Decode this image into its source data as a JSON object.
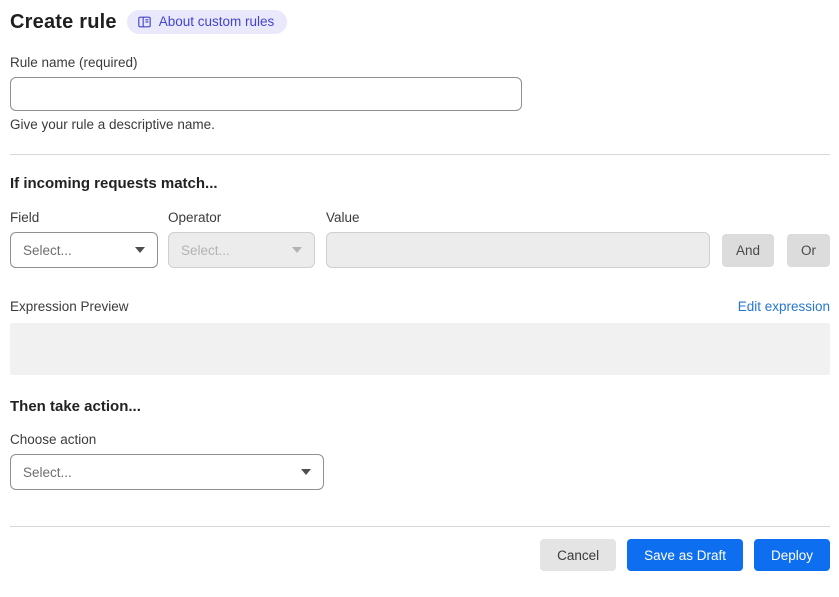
{
  "header": {
    "title": "Create rule",
    "about_badge": {
      "label": "About custom rules",
      "icon": "book-icon"
    }
  },
  "rule_name": {
    "label": "Rule name (required)",
    "value": "",
    "helper": "Give your rule a descriptive name."
  },
  "match_section": {
    "heading": "If incoming requests match...",
    "field": {
      "label": "Field",
      "placeholder": "Select...",
      "icon": "chevron-down-icon"
    },
    "operator": {
      "label": "Operator",
      "placeholder": "Select...",
      "icon": "chevron-down-icon",
      "disabled": true
    },
    "value": {
      "label": "Value",
      "value": "",
      "disabled": true
    },
    "and_button": "And",
    "or_button": "Or"
  },
  "expression_preview": {
    "label": "Expression Preview",
    "edit_link": "Edit expression",
    "value": ""
  },
  "action_section": {
    "heading": "Then take action...",
    "choose_label": "Choose action",
    "select": {
      "placeholder": "Select...",
      "icon": "chevron-down-icon"
    }
  },
  "footer": {
    "cancel": "Cancel",
    "save_draft": "Save as Draft",
    "deploy": "Deploy"
  },
  "colors": {
    "primary_blue": "#0e6ef0",
    "link_blue": "#2577d0",
    "badge_bg": "#e9e9fb",
    "badge_text": "#4343cf",
    "disabled_bg": "#ececec",
    "preview_bg": "#f1f1f1"
  }
}
